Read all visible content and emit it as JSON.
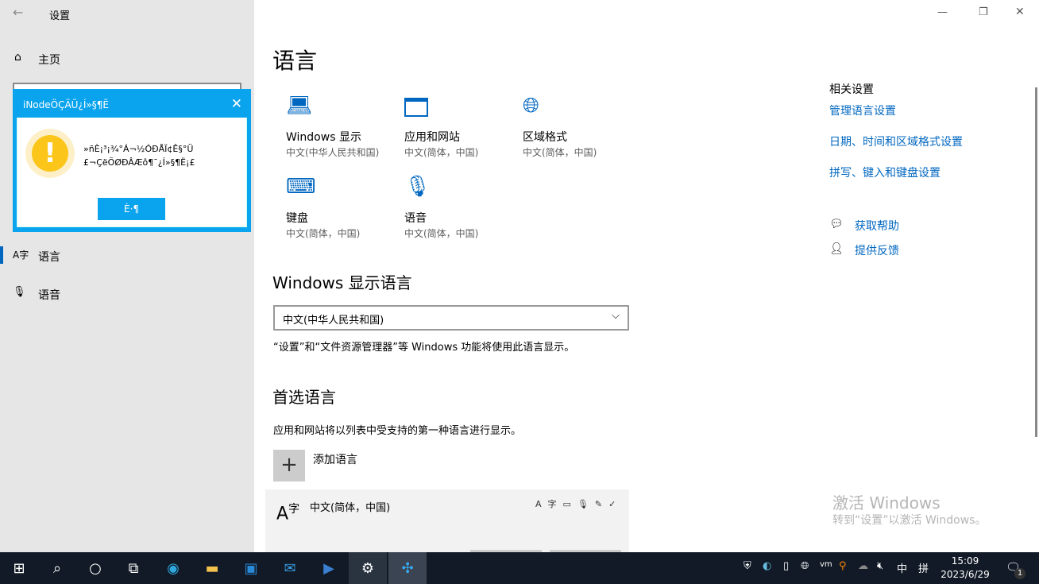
{
  "window": {
    "title": "设置",
    "back": "←",
    "minimize": "—",
    "restore": "❐",
    "close": "✕"
  },
  "sidebar": {
    "home": "主页",
    "items": [
      {
        "label": "语言",
        "icon": "A字"
      },
      {
        "label": "语音",
        "icon": "🎙"
      }
    ]
  },
  "dialog": {
    "title": "iNodeÖÇÄÜ¿Í»§¶Ë",
    "line1": "»ñÈ¡³¡¾°Á¬½ÓÐÅÏ¢Ê§°Ü",
    "line2": "£¬ÇëÖØÐÂÆô¶¯¿Í»§¶Ë¡£",
    "ok": "È·¶"
  },
  "main": {
    "title": "语言",
    "tiles": [
      {
        "label": "Windows 显示",
        "sub": "中文(中华人民共和国)"
      },
      {
        "label": "应用和网站",
        "sub": "中文(简体，中国)"
      },
      {
        "label": "区域格式",
        "sub": "中文(简体，中国)"
      },
      {
        "label": "键盘",
        "sub": "中文(简体，中国)"
      },
      {
        "label": "语音",
        "sub": "中文(简体，中国)"
      }
    ],
    "display_lang_heading": "Windows 显示语言",
    "display_lang_value": "中文(中华人民共和国)",
    "display_lang_note": "“设置”和“文件资源管理器”等 Windows 功能将使用此语言显示。",
    "pref_heading": "首选语言",
    "pref_note": "应用和网站将以列表中受支持的第一种语言进行显示。",
    "add_lang": "添加语言",
    "lang_item": "中文(简体，中国)"
  },
  "related": {
    "heading": "相关设置",
    "links": [
      "管理语言设置",
      "日期、时间和区域格式设置",
      "拼写、键入和键盘设置"
    ],
    "help": "获取帮助",
    "feedback": "提供反馈"
  },
  "watermark": {
    "line1": "激活 Windows",
    "line2": "转到“设置”以激活 Windows。"
  },
  "taskbar": {
    "time": "15:09",
    "date": "2023/6/29",
    "ime": "中",
    "ime2": "拼",
    "notifications": "1"
  }
}
